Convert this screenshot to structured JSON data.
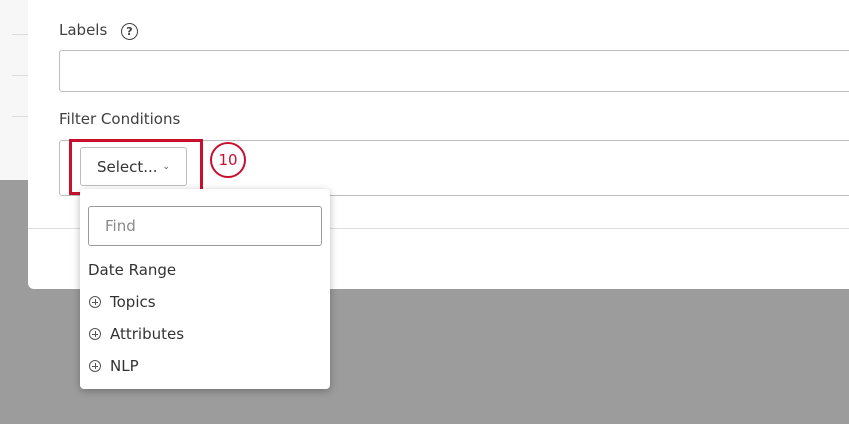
{
  "form": {
    "labels_label": "Labels",
    "labels_help_symbol": "?",
    "labels_value": "",
    "filter_conditions_label": "Filter Conditions",
    "select_button_label": "Select...",
    "select_chevron": "⌄"
  },
  "annotation": {
    "step_number": "10",
    "highlight_color": "#c8102e"
  },
  "dropdown": {
    "search_placeholder": "Find",
    "search_value": "",
    "items": [
      {
        "label": "Date Range",
        "expandable": false
      },
      {
        "label": "Topics",
        "expandable": true,
        "icon": "plus-circle-icon"
      },
      {
        "label": "Attributes",
        "expandable": true,
        "icon": "plus-circle-icon"
      },
      {
        "label": "NLP",
        "expandable": true,
        "icon": "plus-circle-icon"
      }
    ]
  }
}
